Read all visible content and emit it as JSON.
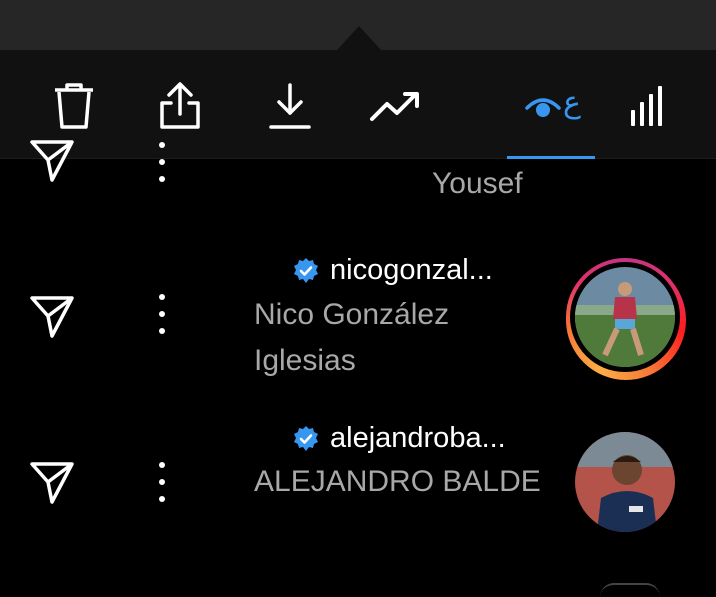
{
  "toolbar": {
    "icons": [
      "trash-icon",
      "share-icon",
      "download-icon",
      "trending-icon",
      "eye-icon",
      "bar-chart-icon"
    ],
    "active_glyph": "ع",
    "active_color": "#3797f0"
  },
  "rows": [
    {
      "username": "",
      "fullname": "Yousef",
      "story_ring": true
    },
    {
      "username": "nicogonzal...",
      "fullname": "Nico González Iglesias",
      "verified": true,
      "story_ring": true
    },
    {
      "username": "alejandroba...",
      "fullname": "ALEJANDRO BALDE",
      "verified": true,
      "story_ring": false
    }
  ],
  "colors": {
    "verified": "#3797f0",
    "secondary_text": "#a8a8a8",
    "background": "#000000"
  }
}
